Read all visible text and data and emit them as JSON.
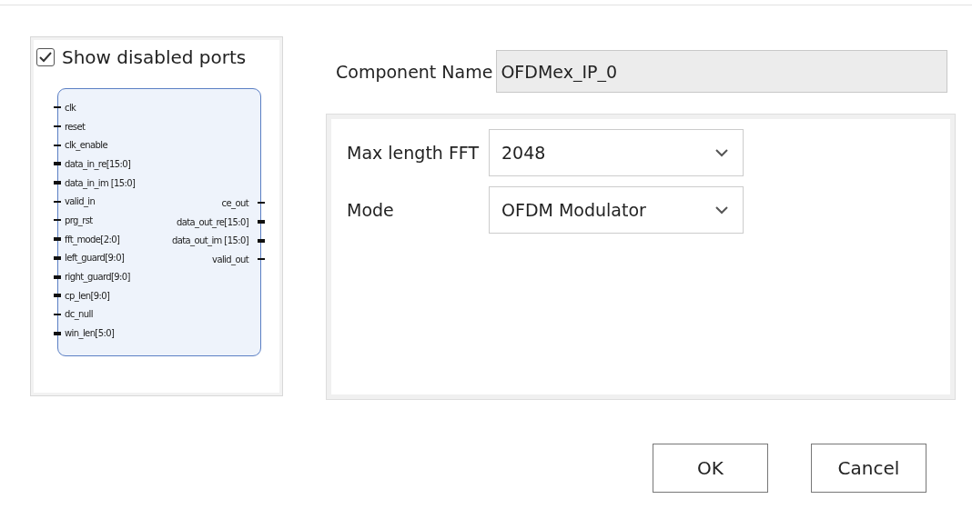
{
  "show_disabled_ports": {
    "label": "Show disabled ports",
    "checked": true
  },
  "symbol": {
    "inputs": [
      {
        "name": "clk",
        "bus": false
      },
      {
        "name": "reset",
        "bus": false
      },
      {
        "name": "clk_enable",
        "bus": false
      },
      {
        "name": "data_in_re[15:0]",
        "bus": true
      },
      {
        "name": "data_in_im [15:0]",
        "bus": true
      },
      {
        "name": "valid_in",
        "bus": false
      },
      {
        "name": "prg_rst",
        "bus": false
      },
      {
        "name": "fft_mode[2:0]",
        "bus": true
      },
      {
        "name": "left_guard[9:0]",
        "bus": true
      },
      {
        "name": "right_guard[9:0]",
        "bus": true
      },
      {
        "name": "cp_len[9:0]",
        "bus": true
      },
      {
        "name": "dc_null",
        "bus": false
      },
      {
        "name": "win_len[5:0]",
        "bus": true
      }
    ],
    "outputs": [
      {
        "name": "ce_out",
        "bus": false
      },
      {
        "name": "data_out_re[15:0]",
        "bus": true
      },
      {
        "name": "data_out_im [15:0]",
        "bus": true
      },
      {
        "name": "valid_out",
        "bus": false
      }
    ]
  },
  "component_name": {
    "label": "Component Name",
    "value": "OFDMex_IP_0"
  },
  "params": [
    {
      "label": "Max length FFT",
      "value": "2048"
    },
    {
      "label": "Mode",
      "value": "OFDM Modulator"
    }
  ],
  "buttons": [
    "OK",
    "Cancel"
  ]
}
